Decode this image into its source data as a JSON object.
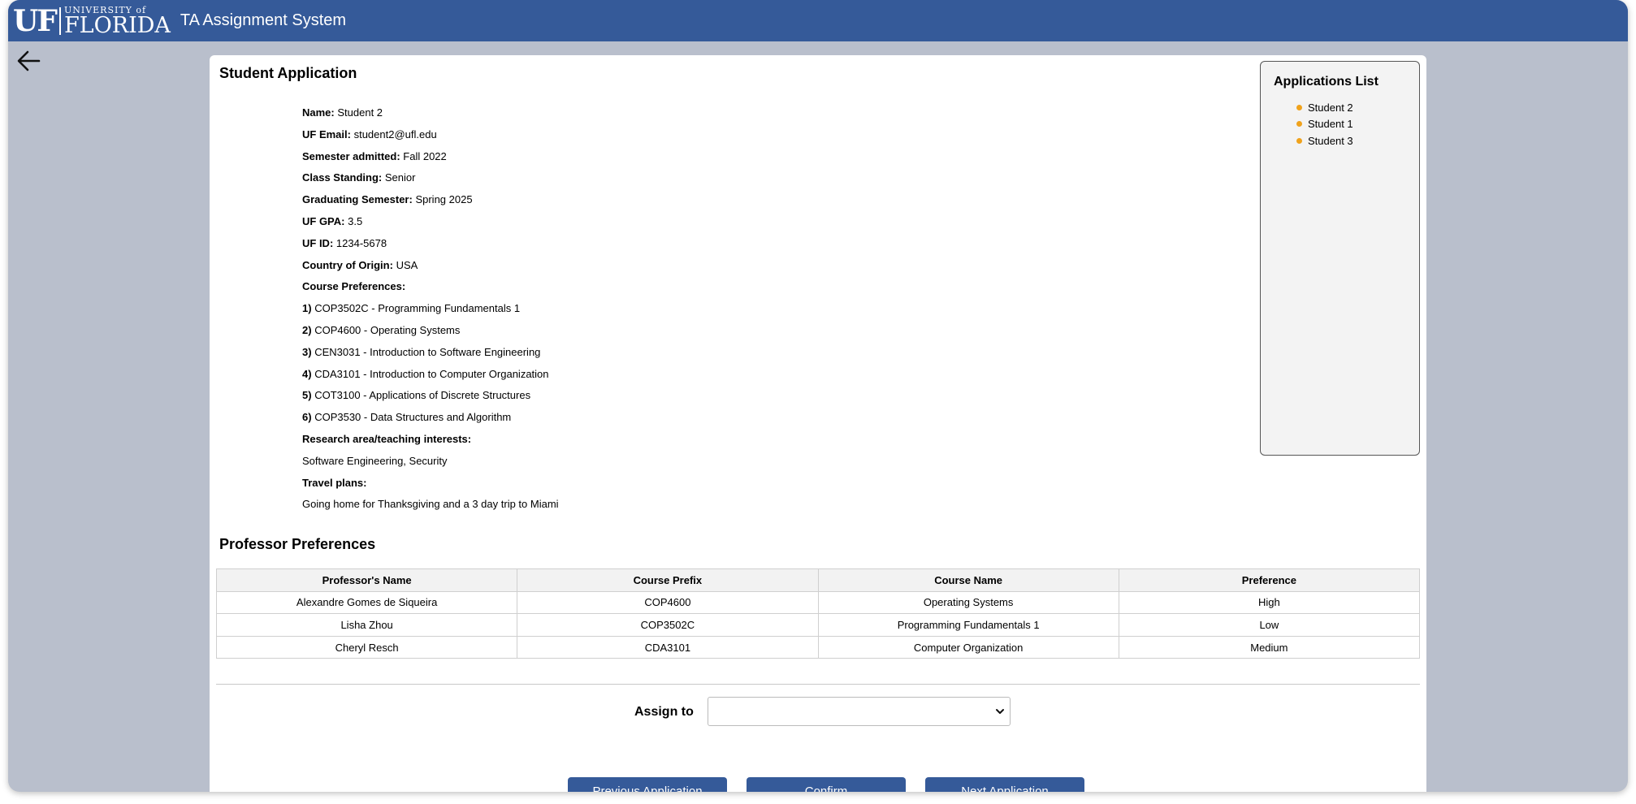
{
  "header": {
    "logo_uf": "UF",
    "logo_university": "UNIVERSITY of",
    "logo_florida": "FLORIDA",
    "app_title": "TA Assignment System"
  },
  "application": {
    "title": "Student Application",
    "fields": [
      {
        "label": "Name:",
        "value": "Student 2"
      },
      {
        "label": "UF Email:",
        "value": "student2@ufl.edu"
      },
      {
        "label": "Semester admitted:",
        "value": "Fall 2022"
      },
      {
        "label": "Class Standing:",
        "value": "Senior"
      },
      {
        "label": "Graduating Semester:",
        "value": "Spring 2025"
      },
      {
        "label": "UF GPA:",
        "value": "3.5"
      },
      {
        "label": "UF ID:",
        "value": "1234-5678"
      },
      {
        "label": "Country of Origin:",
        "value": "USA"
      }
    ],
    "course_preferences_label": "Course Preferences:",
    "course_preferences": [
      {
        "num": "1)",
        "text": "COP3502C - Programming Fundamentals 1"
      },
      {
        "num": "2)",
        "text": "COP4600 - Operating Systems"
      },
      {
        "num": "3)",
        "text": "CEN3031 - Introduction to Software Engineering"
      },
      {
        "num": "4)",
        "text": "CDA3101 - Introduction to Computer Organization"
      },
      {
        "num": "5)",
        "text": "COT3100 - Applications of Discrete Structures"
      },
      {
        "num": "6)",
        "text": "COP3530 - Data Structures and Algorithm"
      }
    ],
    "research_label": "Research area/teaching interests:",
    "research_value": "Software Engineering, Security",
    "travel_label": "Travel plans:",
    "travel_value": "Going home for Thanksgiving and a 3 day trip to Miami"
  },
  "applications_list": {
    "title": "Applications List",
    "items": [
      "Student 2",
      "Student 1",
      "Student 3"
    ],
    "dot_color": "#f0a21b"
  },
  "professor_preferences": {
    "title": "Professor Preferences",
    "columns": [
      "Professor's Name",
      "Course Prefix",
      "Course Name",
      "Preference"
    ],
    "rows": [
      [
        "Alexandre Gomes de Siqueira",
        "COP4600",
        "Operating Systems",
        "High"
      ],
      [
        "Lisha Zhou",
        "COP3502C",
        "Programming Fundamentals 1",
        "Low"
      ],
      [
        "Cheryl Resch",
        "CDA3101",
        "Computer Organization",
        "Medium"
      ]
    ]
  },
  "assign": {
    "label": "Assign to",
    "selected_value": ""
  },
  "buttons": {
    "previous": "Previous Application",
    "confirm": "Confirm",
    "next": "Next Application"
  },
  "colors": {
    "brand_blue": "#355a99",
    "background": "#b9bfcc"
  }
}
